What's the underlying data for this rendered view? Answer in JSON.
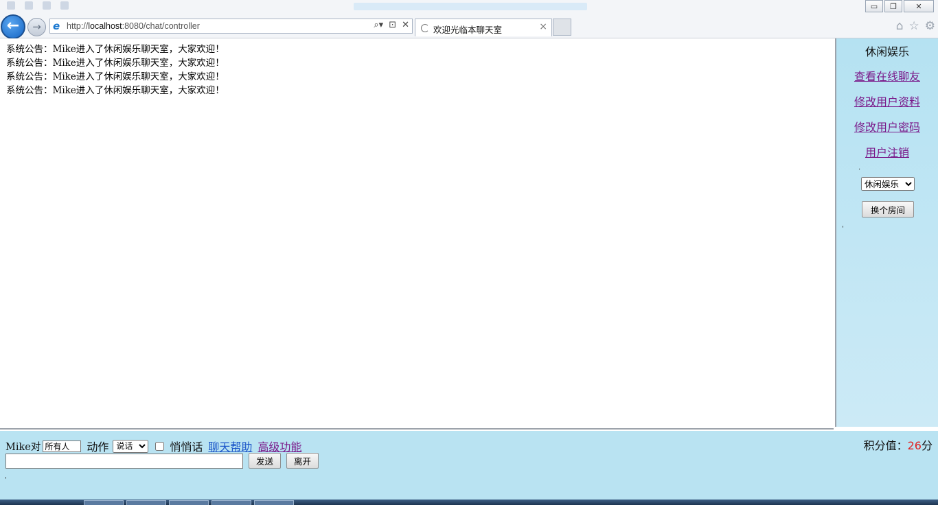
{
  "browser": {
    "address": "http://localhost:8080/chat/controller",
    "address_host": "localhost",
    "tab_title": "欢迎光临本聊天室",
    "window_buttons": [
      "▭",
      "❐",
      "✕"
    ]
  },
  "messages": [
    "系统公告：Mike进入了休闲娱乐聊天室，大家欢迎！",
    "系统公告：Mike进入了休闲娱乐聊天室，大家欢迎！",
    "系统公告：Mike进入了休闲娱乐聊天室，大家欢迎！",
    "系统公告：Mike进入了休闲娱乐聊天室，大家欢迎！"
  ],
  "sidebar": {
    "room_name": "休闲娱乐",
    "links": [
      "查看在线聊友",
      "修改用户资料",
      "修改用户密码",
      "用户注销"
    ],
    "room_select_value": "休闲娱乐",
    "change_room_label": "换个房间"
  },
  "bottom": {
    "user_prefix": "Mike对",
    "target_value": "所有人",
    "action_label": "动作",
    "action_select_value": "说话",
    "whisper_label": "悄悄话",
    "help_link": "聊天帮助",
    "advanced_link": "高级功能",
    "score_label": "积分值：",
    "score_value": "26",
    "score_unit": "分",
    "send_label": "发送",
    "leave_label": "离开"
  }
}
